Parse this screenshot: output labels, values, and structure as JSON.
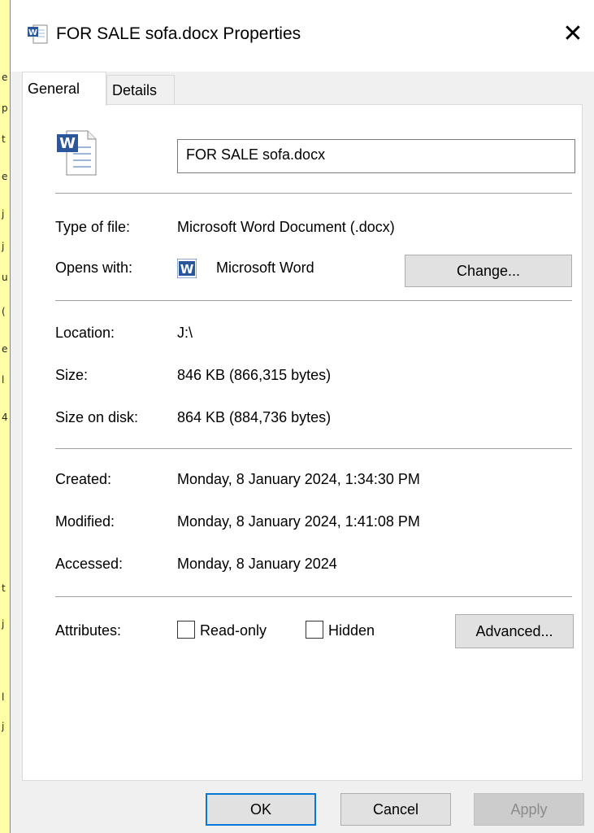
{
  "window": {
    "title": "FOR SALE sofa.docx Properties",
    "close_symbol": "✕"
  },
  "tabs": [
    {
      "label": "General",
      "active": true
    },
    {
      "label": "Details",
      "active": false
    }
  ],
  "general": {
    "file_name": "FOR SALE sofa.docx",
    "type_label": "Type of file:",
    "type_value": "Microsoft Word Document (.docx)",
    "opens_label": "Opens with:",
    "opens_value": "Microsoft Word",
    "change_button": "Change...",
    "location_label": "Location:",
    "location_value": "J:\\",
    "size_label": "Size:",
    "size_value": "846 KB (866,315 bytes)",
    "size_disk_label": "Size on disk:",
    "size_disk_value": "864 KB (884,736 bytes)",
    "created_label": "Created:",
    "created_value": "Monday, 8 January 2024, 1:34:30 PM",
    "modified_label": "Modified:",
    "modified_value": "Monday, 8 January 2024, 1:41:08 PM",
    "accessed_label": "Accessed:",
    "accessed_value": "Monday, 8 January 2024",
    "attributes_label": "Attributes:",
    "readonly_label": "Read-only",
    "readonly_checked": false,
    "hidden_label": "Hidden",
    "hidden_checked": false,
    "advanced_button": "Advanced..."
  },
  "footer": {
    "ok": "OK",
    "cancel": "Cancel",
    "apply": "Apply"
  },
  "background_glyphs": [
    "e",
    "p",
    "t",
    "e",
    "j",
    "j",
    "u",
    "(",
    "e",
    "l",
    "4",
    "t",
    "j",
    "l",
    "j"
  ],
  "colors": {
    "background": "#FFFFA8",
    "dialog": "#F0F0F0",
    "panel": "#FFFFFF",
    "word_blue": "#2B579A",
    "focus_blue": "#0078D7"
  }
}
